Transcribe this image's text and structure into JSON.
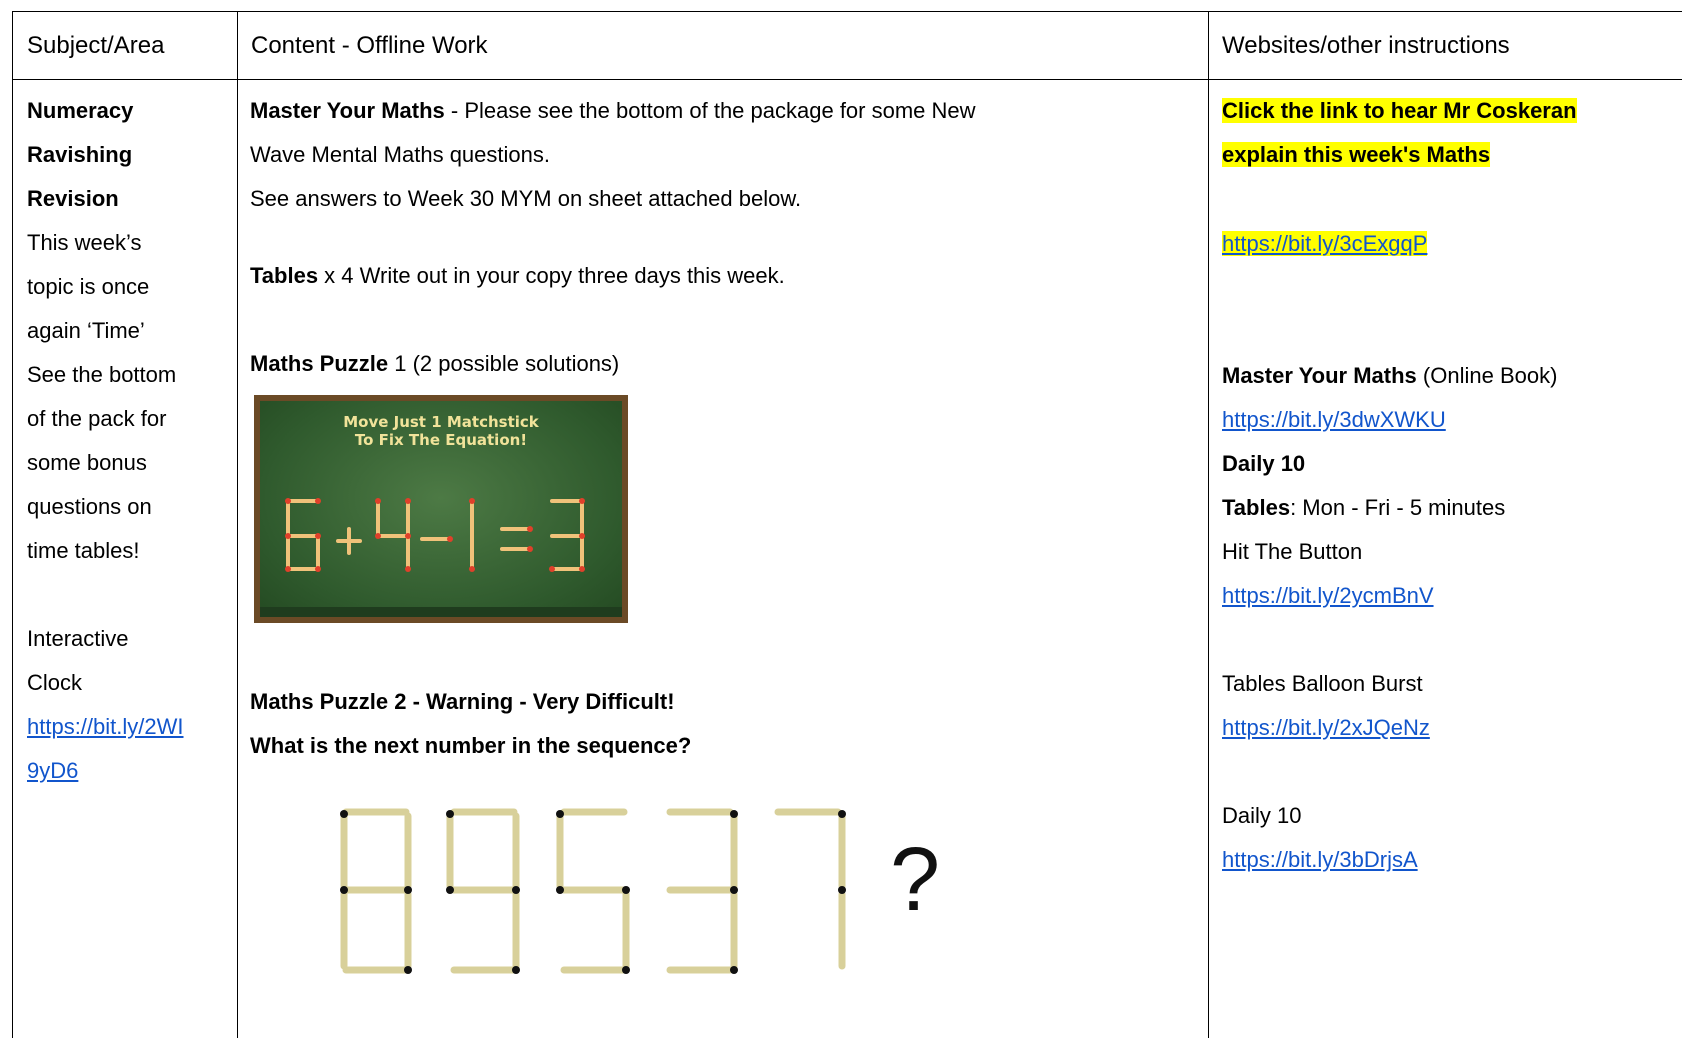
{
  "header": {
    "col1": "Subject/Area",
    "col2": "Content - Offline Work",
    "col3": "Websites/other instructions"
  },
  "col1": {
    "subject": "Numeracy",
    "title_line1": "Ravishing",
    "title_line2": "Revision",
    "text_lines": [
      "This week’s",
      "topic is once",
      "again ‘Time’",
      "See the bottom",
      "of the pack for",
      "some bonus",
      "questions on",
      "time tables!"
    ],
    "clock_line1": "Interactive",
    "clock_line2": "Clock",
    "clock_link_line1": "https://bit.ly/2WI",
    "clock_link_line2": "9yD6"
  },
  "col2": {
    "mym_title": "Master Your Maths",
    "mym_text1": " - Please see the bottom of the package for some New",
    "mym_text2": "Wave Mental Maths questions.",
    "mym_text3": "See answers to Week 30  MYM on sheet attached below.",
    "tables_title": "Tables",
    "tables_text": "  x 4 Write out in your copy three days this week.",
    "puzzle1_title": "Maths Puzzle",
    "puzzle1_text": " 1 (2 possible solutions)",
    "puzzle1_image_line1": "Move Just 1 Matchstick",
    "puzzle1_image_line2": "To Fix The Equation!",
    "puzzle2_line1": "Maths Puzzle 2 - Warning - Very Difficult!",
    "puzzle2_line2": "What is the next number in the sequence?",
    "puzzle2_question_mark": "?"
  },
  "col3": {
    "video_line1": "Click the link to hear Mr Coskeran",
    "video_line2": "explain this week's Maths",
    "video_link": "https://bit.ly/3cExgqP",
    "mym_title": "Master Your Maths",
    "mym_suffix": " (Online Book)",
    "mym_link": "https://bit.ly/3dwXWKU",
    "daily10_title": "Daily 10",
    "tables_title": "Tables",
    "tables_text": ":   Mon - Fri - 5 minutes",
    "hit_button": "Hit The Button",
    "hit_link": "https://bit.ly/2ycmBnV",
    "balloon": "Tables Balloon Burst",
    "balloon_link": "https://bit.ly/2xJQeNz",
    "daily10_text": "Daily 10",
    "daily10_link": "https://bit.ly/3bDrjsA"
  }
}
